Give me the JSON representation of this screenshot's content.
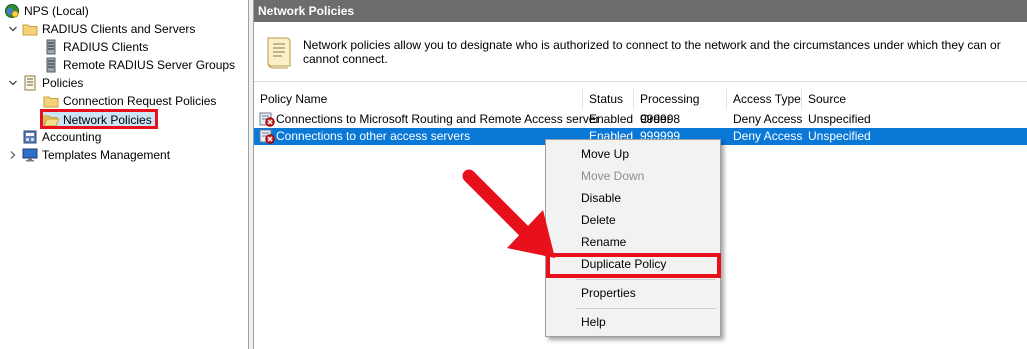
{
  "tree": {
    "root_label": "NPS (Local)",
    "items": [
      {
        "label": "RADIUS Clients and Servers"
      },
      {
        "label": "RADIUS Clients"
      },
      {
        "label": "Remote RADIUS Server Groups"
      },
      {
        "label": "Policies"
      },
      {
        "label": "Connection Request Policies"
      },
      {
        "label": "Network Policies"
      },
      {
        "label": "Accounting"
      },
      {
        "label": "Templates Management"
      }
    ]
  },
  "pane": {
    "title": "Network Policies",
    "description": "Network policies allow you to designate who is authorized to connect to the network and the circumstances under which they can or cannot connect."
  },
  "table": {
    "columns": [
      "Policy Name",
      "Status",
      "Processing Order",
      "Access Type",
      "Source"
    ],
    "rows": [
      {
        "name": "Connections to Microsoft Routing and Remote Access server",
        "status": "Enabled",
        "order": "999998",
        "access": "Deny Access",
        "source": "Unspecified"
      },
      {
        "name": "Connections to other access servers",
        "status": "Enabled",
        "order": "999999",
        "access": "Deny Access",
        "source": "Unspecified"
      }
    ]
  },
  "context_menu": {
    "items": [
      {
        "label": "Move Up",
        "enabled": true
      },
      {
        "label": "Move Down",
        "enabled": false
      },
      {
        "label": "Disable",
        "enabled": true
      },
      {
        "label": "Delete",
        "enabled": true
      },
      {
        "label": "Rename",
        "enabled": true
      },
      {
        "label": "Duplicate Policy",
        "enabled": true
      },
      {
        "label": "Properties",
        "enabled": true
      },
      {
        "label": "Help",
        "enabled": true
      }
    ]
  },
  "icons": {
    "root": "nps-globe-icon",
    "folder": "folder-icon",
    "server": "server-icon",
    "policies": "policies-document-icon",
    "accounting": "accounting-book-icon",
    "templates": "templates-monitor-icon",
    "policy_deny": "deny-policy-icon",
    "description": "scroll-document-icon"
  },
  "colors": {
    "highlight_red": "#e8101a",
    "selection_blue": "#0a78d7",
    "header_gray": "#6d6d6d"
  }
}
